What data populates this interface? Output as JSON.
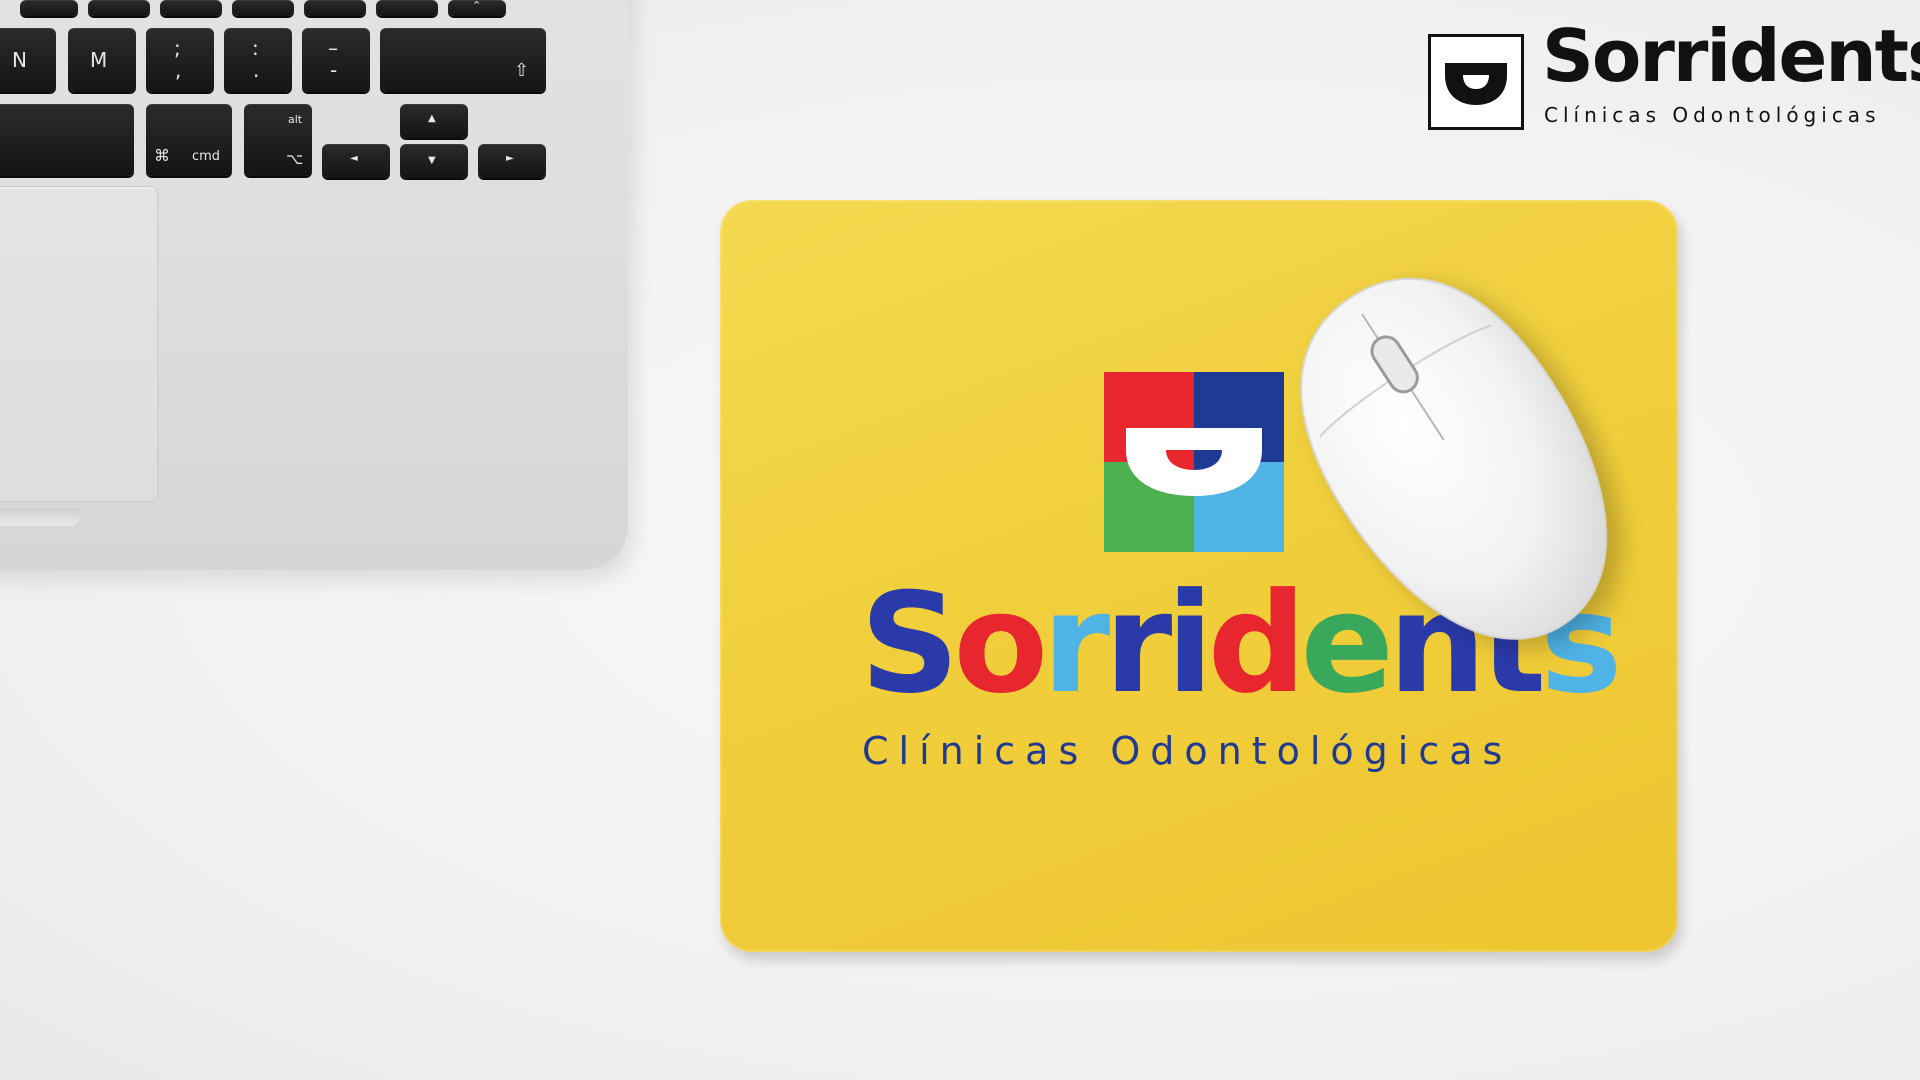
{
  "scene": {
    "background": "#f1f1f1"
  },
  "laptop": {
    "keys": {
      "n": "N",
      "m": "M",
      "semicolon_top": ";",
      "semicolon_bottom": ",",
      "colon_top": ":",
      "colon_bottom": ".",
      "dash_top": "–",
      "dash_bottom": "-",
      "shift_glyph": "⇧",
      "cmd_symbol": "⌘",
      "cmd_label": "cmd",
      "alt_label": "alt",
      "option_glyph": "⌥",
      "arrow_left": "◄",
      "arrow_up": "▲",
      "arrow_down": "▼",
      "arrow_right": "►",
      "eject_glyph": "⌃"
    }
  },
  "brand": {
    "name": "Sorridents",
    "subtitle": "Clínicas Odontológicas",
    "color": "#111111"
  },
  "mousepad": {
    "color": "#f1cf3c",
    "logo_name_letters": [
      "S",
      "o",
      "r",
      "r",
      "i",
      "d",
      "e",
      "n",
      "t",
      "s"
    ],
    "logo_letter_colors": [
      "#2a3aa8",
      "#e8262e",
      "#4fb3e6",
      "#2a3aa8",
      "#2a3aa8",
      "#e8262e",
      "#3aa85a",
      "#2a3aa8",
      "#2a3aa8",
      "#4fb3e6"
    ],
    "logo_subtitle": "Clínicas Odontológicas",
    "mark_colors": {
      "top_left": "#e8262e",
      "top_right": "#1f3a93",
      "bottom_left": "#4caf50",
      "bottom_right": "#4fb3e6"
    }
  },
  "mouse": {
    "color": "#f7f7f7"
  }
}
